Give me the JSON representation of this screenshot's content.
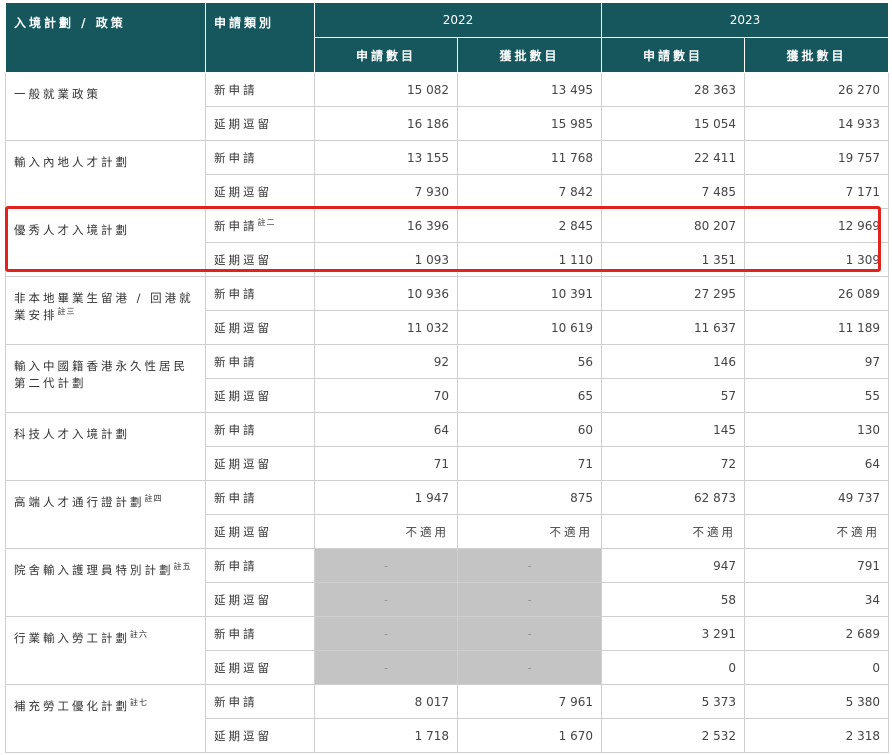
{
  "header": {
    "scheme": "入境計劃 / 政策",
    "type": "申請類別",
    "years": [
      "2022",
      "2023"
    ],
    "sub": [
      "申請數目",
      "獲批數目",
      "申請數目",
      "獲批數目"
    ]
  },
  "rows": [
    {
      "name": "一般就業政策",
      "note": "",
      "apps": [
        {
          "type": "新申請",
          "cells": [
            "15 082",
            "13 495",
            "28 363",
            "26 270"
          ]
        },
        {
          "type": "延期逗留",
          "cells": [
            "16 186",
            "15 985",
            "15 054",
            "14 933"
          ]
        }
      ]
    },
    {
      "name": "輸入內地人才計劃",
      "note": "",
      "apps": [
        {
          "type": "新申請",
          "cells": [
            "13 155",
            "11 768",
            "22 411",
            "19 757"
          ]
        },
        {
          "type": "延期逗留",
          "cells": [
            "7 930",
            "7 842",
            "7 485",
            "7 171"
          ]
        }
      ]
    },
    {
      "name": "優秀人才入境計劃",
      "note": "",
      "apps": [
        {
          "type": "新申請",
          "type_note": "註二",
          "cells": [
            "16 396",
            "2 845",
            "80 207",
            "12 969"
          ]
        },
        {
          "type": "延期逗留",
          "cells": [
            "1 093",
            "1 110",
            "1 351",
            "1 309"
          ]
        }
      ]
    },
    {
      "name": "非本地畢業生留港 / 回港就業安排",
      "note": "註三",
      "apps": [
        {
          "type": "新申請",
          "cells": [
            "10 936",
            "10 391",
            "27 295",
            "26 089"
          ]
        },
        {
          "type": "延期逗留",
          "cells": [
            "11 032",
            "10 619",
            "11 637",
            "11 189"
          ]
        }
      ]
    },
    {
      "name": "輸入中國籍香港永久性居民第二代計劃",
      "note": "",
      "apps": [
        {
          "type": "新申請",
          "cells": [
            "92",
            "56",
            "146",
            "97"
          ]
        },
        {
          "type": "延期逗留",
          "cells": [
            "70",
            "65",
            "57",
            "55"
          ]
        }
      ]
    },
    {
      "name": "科技人才入境計劃",
      "note": "",
      "apps": [
        {
          "type": "新申請",
          "cells": [
            "64",
            "60",
            "145",
            "130"
          ]
        },
        {
          "type": "延期逗留",
          "cells": [
            "71",
            "71",
            "72",
            "64"
          ]
        }
      ]
    },
    {
      "name": "高端人才通行證計劃",
      "note": "註四",
      "apps": [
        {
          "type": "新申請",
          "cells": [
            "1 947",
            "875",
            "62 873",
            "49 737"
          ]
        },
        {
          "type": "延期逗留",
          "cells": [
            "不適用",
            "不適用",
            "不適用",
            "不適用"
          ]
        }
      ]
    },
    {
      "name": "院舍輸入護理員特別計劃",
      "note": "註五",
      "apps": [
        {
          "type": "新申請",
          "cells": [
            "-",
            "-",
            "947",
            "791"
          ]
        },
        {
          "type": "延期逗留",
          "cells": [
            "-",
            "-",
            "58",
            "34"
          ]
        }
      ]
    },
    {
      "name": "行業輸入勞工計劃",
      "note": "註六",
      "apps": [
        {
          "type": "新申請",
          "cells": [
            "-",
            "-",
            "3 291",
            "2 689"
          ]
        },
        {
          "type": "延期逗留",
          "cells": [
            "-",
            "-",
            "0",
            "0"
          ]
        }
      ]
    },
    {
      "name": "補充勞工優化計劃",
      "note": "註七",
      "apps": [
        {
          "type": "新申請",
          "cells": [
            "8 017",
            "7 961",
            "5 373",
            "5 380"
          ]
        },
        {
          "type": "延期逗留",
          "cells": [
            "1 718",
            "1 670",
            "2 532",
            "2 318"
          ]
        }
      ]
    }
  ],
  "colors": {
    "header_bg": "#16575e",
    "highlight": "#e0241b",
    "na_bg": "#c4c4c4"
  }
}
